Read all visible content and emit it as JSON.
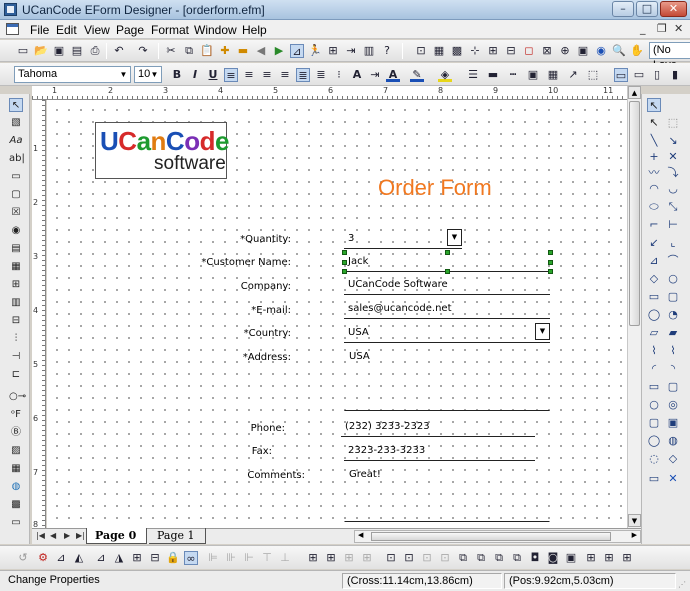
{
  "window": {
    "title": "UCanCode EForm Designer - [orderform.efm]",
    "minimize_glyph": "–",
    "maximize_glyph": "□",
    "close_glyph": "✕"
  },
  "menu": {
    "items": [
      "File",
      "Edit",
      "View",
      "Page",
      "Format",
      "Window",
      "Help"
    ],
    "mdi_min": "_",
    "mdi_restore": "❐",
    "mdi_close": "✕"
  },
  "toolbar_top": {
    "layer_combo": "(No Laye"
  },
  "format_bar": {
    "font_name": "Tahoma",
    "font_size": "10"
  },
  "logo": {
    "line1": [
      "U",
      "C",
      "a",
      "n",
      "C",
      "o",
      "d",
      "e"
    ],
    "line2": "software"
  },
  "form": {
    "title": "Order Form",
    "labels": {
      "quantity": "*Quantity:",
      "customer_name": "*Customer Name:",
      "company": "Company:",
      "email": "*E-mail:",
      "country": "*Country:",
      "address": "*Address:",
      "phone": "Phone:",
      "fax": "Fax:",
      "comments": "Comments:"
    },
    "values": {
      "quantity": "3",
      "customer_name": "Jack",
      "company": "UCanCode Software",
      "email": "sales@ucancode.net",
      "country": "USA",
      "address": "USA",
      "phone": "(232) 3233-2323",
      "fax": "2323-233-3233",
      "comments": "Great!"
    },
    "dropdown_glyph": "▼"
  },
  "rulers": {
    "top": [
      "1",
      "2",
      "3",
      "4",
      "5",
      "6",
      "7",
      "8",
      "9",
      "10",
      "11"
    ],
    "left": [
      "1",
      "2",
      "3",
      "4",
      "5",
      "6",
      "7",
      "8"
    ]
  },
  "tabs": {
    "nav": [
      "|◀",
      "◀",
      "▶",
      "▶|"
    ],
    "items": [
      {
        "label": "Page 0",
        "active": true
      },
      {
        "label": "Page 1",
        "active": false
      }
    ]
  },
  "status": {
    "message": "Change Properties",
    "cross": "(Cross:11.14cm,13.86cm)",
    "pos": "(Pos:9.92cm,5.03cm)"
  },
  "icons": {
    "toolbar_top": [
      "new-icon",
      "open-icon",
      "save-icon",
      "save-all-icon",
      "print-icon",
      "cut-icon",
      "copy-icon",
      "paste-icon",
      "undo-icon",
      "redo-icon",
      "scissors-icon",
      "insert-icon",
      "add-icon",
      "remove-icon",
      "back-icon",
      "forward-icon",
      "layout-icon",
      "run-icon",
      "properties-icon",
      "script-icon",
      "preview-icon",
      "help-icon",
      "align-icon",
      "grid-icon",
      "snap-icon",
      "zoom-in-icon",
      "zoom-out-icon",
      "hand-icon"
    ],
    "left_palette": [
      "select-icon",
      "image-icon",
      "text-icon",
      "label-icon",
      "field-icon",
      "button-icon",
      "checkbox-icon",
      "radio-icon",
      "list-icon",
      "table-icon",
      "grid-icon",
      "date-icon",
      "tab-icon",
      "barcode-icon",
      "line-icon",
      "chart-icon",
      "frame-icon",
      "globe-icon",
      "picture-icon",
      "panel-icon"
    ],
    "right_palette": [
      "pointer-icon",
      "rotate-icon",
      "line-icon",
      "arrow-icon",
      "cross-icon",
      "curve-icon",
      "rectangle-icon",
      "ellipse-icon",
      "polygon-icon",
      "arc-icon",
      "star-icon",
      "bezier-icon"
    ]
  },
  "colors": {
    "form_title": "#f07820",
    "selection_handle": "#2aa52a",
    "chrome": "#d4d0c8"
  }
}
